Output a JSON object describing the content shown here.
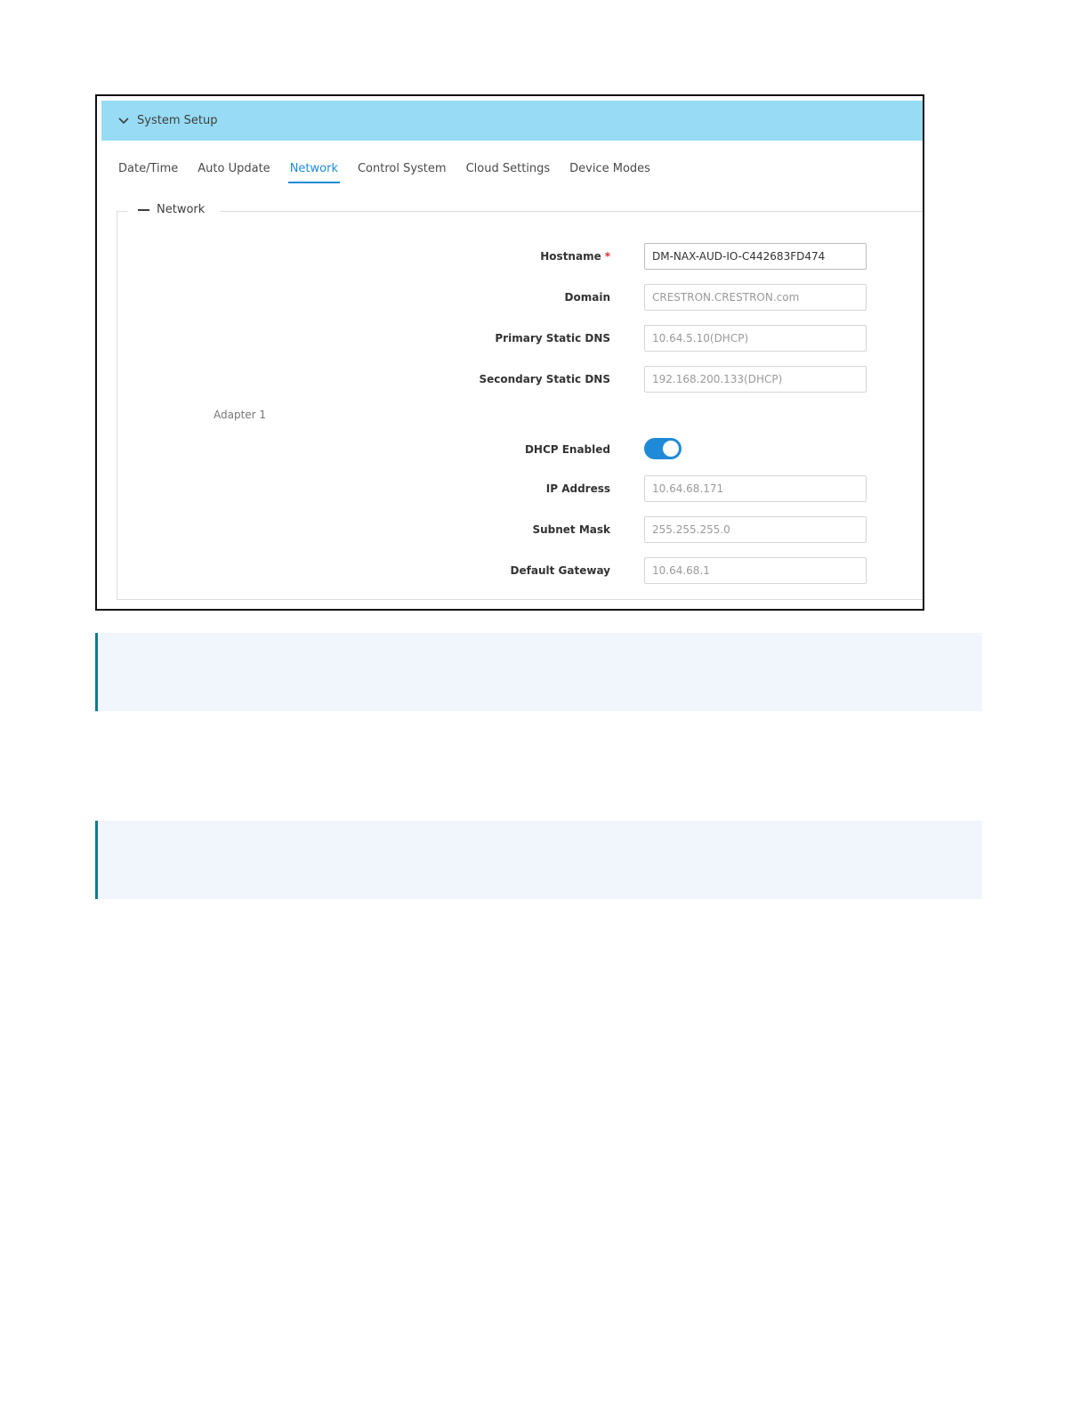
{
  "section": {
    "title": "System Setup"
  },
  "tabs": [
    {
      "label": "Date/Time"
    },
    {
      "label": "Auto Update"
    },
    {
      "label": "Network"
    },
    {
      "label": "Control System"
    },
    {
      "label": "Cloud Settings"
    },
    {
      "label": "Device Modes"
    }
  ],
  "active_tab": "Network",
  "fieldset": {
    "legend": "Network",
    "adapter_label": "Adapter 1"
  },
  "fields": {
    "hostname": {
      "label": "Hostname",
      "required_mark": "*",
      "value": "DM-NAX-AUD-IO-C442683FD474"
    },
    "domain": {
      "label": "Domain",
      "value": "CRESTRON.CRESTRON.com"
    },
    "primary_dns": {
      "label": "Primary Static DNS",
      "value": "10.64.5.10(DHCP)"
    },
    "secondary_dns": {
      "label": "Secondary Static DNS",
      "value": "192.168.200.133(DHCP)"
    },
    "dhcp": {
      "label": "DHCP Enabled",
      "enabled": true
    },
    "ip_address": {
      "label": "IP Address",
      "value": "10.64.68.171"
    },
    "subnet_mask": {
      "label": "Subnet Mask",
      "value": "255.255.255.0"
    },
    "default_gateway": {
      "label": "Default Gateway",
      "value": "10.64.68.1"
    }
  },
  "colors": {
    "header_bg": "#97dcf4",
    "accent": "#1f8bd8",
    "note_bg": "#f1f6fc",
    "note_border": "#0e7a91",
    "required": "#e0302c"
  },
  "icons": {
    "section_toggle": "chevron-down-icon",
    "legend_toggle": "collapse-minus-icon"
  }
}
